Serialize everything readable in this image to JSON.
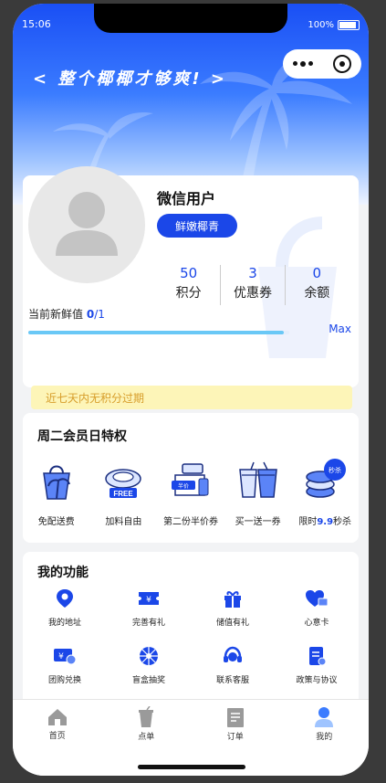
{
  "status_bar": {
    "time": "15:06",
    "battery": "100%"
  },
  "hero": {
    "slogan": "< 整个椰椰才够爽! >"
  },
  "profile": {
    "nickname": "微信用户",
    "level": "鲜嫩椰青",
    "stats": [
      {
        "value": "50",
        "label": "积分"
      },
      {
        "value": "3",
        "label": "优惠券"
      },
      {
        "value": "0",
        "label": "余额"
      }
    ],
    "freshness_label": "当前新鲜值",
    "freshness_value": "0",
    "freshness_total": "/1",
    "freshness_progress": 0.98,
    "max_label": "Max"
  },
  "notice": "近七天内无积分过期",
  "privileges": {
    "title": "周二会员日特权",
    "items": [
      {
        "label": "免配送费",
        "icon": "shopping-bag-icon"
      },
      {
        "label": "加料自由",
        "icon": "free-coconut-icon"
      },
      {
        "label": "第二份半价券",
        "icon": "half-price-icon"
      },
      {
        "label": "买一送一券",
        "icon": "bogo-cups-icon"
      },
      {
        "label_prefix": "限时",
        "label_value": "9.9",
        "label_suffix": "秒杀",
        "icon": "flash-sale-icon"
      }
    ]
  },
  "features": {
    "title": "我的功能",
    "items": [
      {
        "label": "我的地址",
        "icon": "location-pin-icon"
      },
      {
        "label": "完善有礼",
        "icon": "ticket-icon"
      },
      {
        "label": "储值有礼",
        "icon": "gift-icon"
      },
      {
        "label": "心意卡",
        "icon": "heart-card-icon"
      },
      {
        "label": "团购兑换",
        "icon": "exchange-voucher-icon"
      },
      {
        "label": "盲盒抽奖",
        "icon": "lottery-wheel-icon"
      },
      {
        "label": "联系客服",
        "icon": "headset-icon"
      },
      {
        "label": "政策与协议",
        "icon": "document-icon"
      }
    ]
  },
  "tabbar": {
    "items": [
      {
        "label": "首页",
        "icon": "home-icon"
      },
      {
        "label": "点单",
        "icon": "drink-cup-icon"
      },
      {
        "label": "订单",
        "icon": "order-icon"
      },
      {
        "label": "我的",
        "icon": "user-icon"
      }
    ],
    "active_index": 3
  },
  "colors": {
    "brand_blue": "#1b47e8",
    "progress": "#6ac8f6",
    "notice_bg": "#fdf5b8",
    "notice_text": "#d79d2a"
  }
}
